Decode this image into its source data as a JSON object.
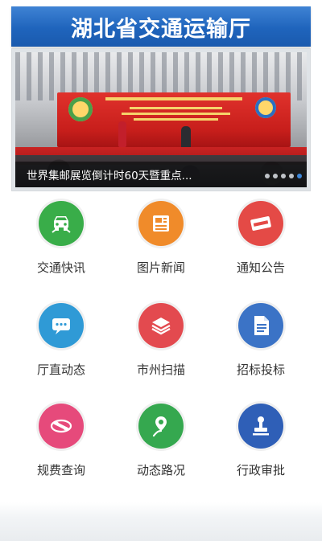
{
  "header": {
    "title": "湖北省交通运输厅"
  },
  "banner": {
    "caption": "世界集邮展览倒计时60天暨重点...",
    "slide_count": 5,
    "active_slide_index": 4
  },
  "tiles": [
    {
      "label": "交通快讯",
      "icon": "car-icon",
      "color": "#39ad49"
    },
    {
      "label": "图片新闻",
      "icon": "photo-news-icon",
      "color": "#f08b2a"
    },
    {
      "label": "通知公告",
      "icon": "notice-icon",
      "color": "#e44a46"
    },
    {
      "label": "厅直动态",
      "icon": "chat-icon",
      "color": "#2f9ad6"
    },
    {
      "label": "市州扫描",
      "icon": "layers-icon",
      "color": "#e34a4f"
    },
    {
      "label": "招标投标",
      "icon": "document-icon",
      "color": "#3b73c6"
    },
    {
      "label": "规费查询",
      "icon": "ticket-icon",
      "color": "#e64a7b"
    },
    {
      "label": "动态路况",
      "icon": "road-pin-icon",
      "color": "#35a84f"
    },
    {
      "label": "行政审批",
      "icon": "stamp-icon",
      "color": "#2f5fb7"
    }
  ]
}
